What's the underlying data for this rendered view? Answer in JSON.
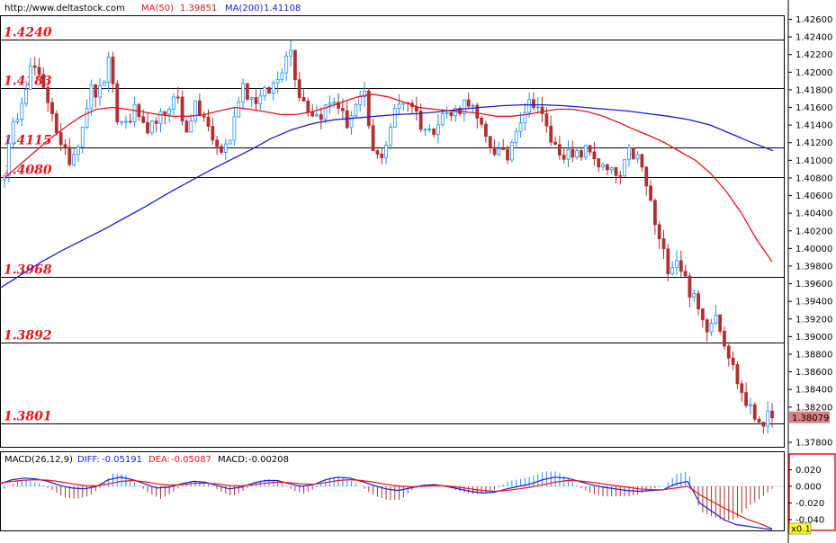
{
  "header": {
    "site": "http://www.deltastock.com",
    "ma50_label": "MA(50)",
    "ma50_value": "1.39851",
    "ma200_label": "MA(200)",
    "ma200_value": "1.41108"
  },
  "colors": {
    "up": "#1e90ff",
    "down": "#b03030",
    "ma50": "#e8141c",
    "ma200": "#1a1ad6",
    "level_text": "#e8141c",
    "price_tag": "#d98080",
    "panel_border": "#e8141c"
  },
  "chart_data": [
    {
      "type": "candlestick",
      "ylim": [
        1.377,
        1.427
      ],
      "y_ticks": [
        "1.42600",
        "1.42400",
        "1.42200",
        "1.42000",
        "1.41800",
        "1.41600",
        "1.41400",
        "1.41200",
        "1.41000",
        "1.40800",
        "1.40600",
        "1.40400",
        "1.40200",
        "1.40000",
        "1.39800",
        "1.39600",
        "1.39400",
        "1.39200",
        "1.39000",
        "1.38800",
        "1.38600",
        "1.38400",
        "1.38200",
        "1.37800"
      ],
      "current_price": "1.38079",
      "levels": [
        {
          "label": "1.4240",
          "value": 1.4237
        },
        {
          "label": "1.4183",
          "value": 1.4182
        },
        {
          "label": "1.4115",
          "value": 1.4115
        },
        {
          "label": "1.4080",
          "value": 1.4081
        },
        {
          "label": "1.3968",
          "value": 1.3968
        },
        {
          "label": "1.3892",
          "value": 1.3893
        },
        {
          "label": "1.3801",
          "value": 1.3801
        }
      ],
      "close_path": [
        1.409,
        1.414,
        1.418,
        1.421,
        1.418,
        1.416,
        1.411,
        1.41,
        1.413,
        1.418,
        1.4175,
        1.421,
        1.414,
        1.4145,
        1.416,
        1.412,
        1.415,
        1.4145,
        1.4185,
        1.413,
        1.416,
        1.415,
        1.412,
        1.411,
        1.413,
        1.419,
        1.417,
        1.417,
        1.418,
        1.4195,
        1.4235,
        1.418,
        1.416,
        1.415,
        1.416,
        1.417,
        1.414,
        1.416,
        1.417,
        1.41,
        1.411,
        1.415,
        1.417,
        1.4165,
        1.414,
        1.413,
        1.4155,
        1.415,
        1.416,
        1.417,
        1.414,
        1.412,
        1.411,
        1.41,
        1.414,
        1.416,
        1.417,
        1.414,
        1.4115,
        1.411,
        1.41,
        1.411,
        1.411,
        1.409,
        1.4085,
        1.408,
        1.411,
        1.41,
        1.406,
        1.401,
        1.398,
        1.399,
        1.396,
        1.3935,
        1.391,
        1.393,
        1.3895,
        1.386,
        1.383,
        1.381,
        1.3805,
        1.3808
      ],
      "ma50": [
        1.408,
        1.4095,
        1.411,
        1.4125,
        1.4138,
        1.415,
        1.4158,
        1.416,
        1.4158,
        1.4155,
        1.4152,
        1.415,
        1.415,
        1.4152,
        1.4156,
        1.416,
        1.4158,
        1.4155,
        1.4152,
        1.4152,
        1.4155,
        1.416,
        1.4166,
        1.4172,
        1.4175,
        1.4172,
        1.4166,
        1.416,
        1.4158,
        1.4156,
        1.4155,
        1.4153,
        1.415,
        1.415,
        1.4152,
        1.4155,
        1.4158,
        1.4158,
        1.4155,
        1.415,
        1.4143,
        1.4135,
        1.4128,
        1.412,
        1.411,
        1.41,
        1.4085,
        1.4065,
        1.404,
        1.401,
        1.3985
      ],
      "ma200": [
        1.3955,
        1.397,
        1.3985,
        1.3998,
        1.401,
        1.4022,
        1.4035,
        1.4048,
        1.4062,
        1.4075,
        1.4088,
        1.41,
        1.4112,
        1.4125,
        1.4135,
        1.4142,
        1.4146,
        1.4148,
        1.415,
        1.4152,
        1.4153,
        1.4155,
        1.4158,
        1.416,
        1.4162,
        1.4163,
        1.4163,
        1.4162,
        1.416,
        1.4158,
        1.4156,
        1.4153,
        1.415,
        1.4146,
        1.414,
        1.413,
        1.412,
        1.4111
      ]
    },
    {
      "type": "macd",
      "title": "MACD(26,12,9)",
      "diff_label": "DIFF:",
      "diff_value": "-0.05191",
      "dea_label": "DEA:",
      "dea_value": "-0.05087",
      "macd_label": "MACD:",
      "macd_value": "-0.00208",
      "ylim": [
        -0.05,
        0.03
      ],
      "y_ticks": [
        "0.020",
        "0.000",
        "-0.020",
        "-0.040"
      ],
      "scale_tag": "x0.1",
      "diff_path": [
        0.003,
        0.008,
        0.01,
        0.009,
        0.006,
        0.001,
        -0.002,
        -0.003,
        0.0,
        0.008,
        0.011,
        0.008,
        0.003,
        -0.002,
        -0.001,
        0.003,
        0.006,
        0.005,
        0.001,
        -0.003,
        -0.001,
        0.004,
        0.007,
        0.007,
        0.003,
        0.0,
        0.002,
        0.008,
        0.011,
        0.01,
        0.006,
        0.001,
        -0.003,
        -0.005,
        -0.002,
        0.001,
        0.002,
        0.0,
        -0.003,
        -0.006,
        -0.008,
        -0.007,
        -0.003,
        0.0,
        0.003,
        0.008,
        0.011,
        0.01,
        0.006,
        0.002,
        -0.001,
        -0.003,
        -0.005,
        -0.006,
        -0.005,
        -0.004,
        0.003,
        0.006,
        -0.02,
        -0.03,
        -0.04,
        -0.046,
        -0.048,
        -0.05,
        -0.0519
      ],
      "dea_path": [
        0.004,
        0.006,
        0.0075,
        0.008,
        0.0075,
        0.0055,
        0.003,
        0.001,
        0.0005,
        0.003,
        0.006,
        0.007,
        0.0055,
        0.003,
        0.0015,
        0.002,
        0.0035,
        0.004,
        0.003,
        0.001,
        0.0005,
        0.002,
        0.004,
        0.005,
        0.0045,
        0.003,
        0.0025,
        0.0045,
        0.007,
        0.008,
        0.007,
        0.005,
        0.0025,
        0.0005,
        -0.0005,
        0.0,
        0.001,
        0.0005,
        -0.001,
        -0.003,
        -0.005,
        -0.006,
        -0.005,
        -0.003,
        -0.001,
        0.002,
        0.005,
        0.007,
        0.0065,
        0.005,
        0.003,
        0.001,
        -0.001,
        -0.003,
        -0.004,
        -0.004,
        -0.002,
        0.0,
        -0.01,
        -0.018,
        -0.026,
        -0.033,
        -0.04,
        -0.045,
        -0.0509
      ]
    }
  ]
}
